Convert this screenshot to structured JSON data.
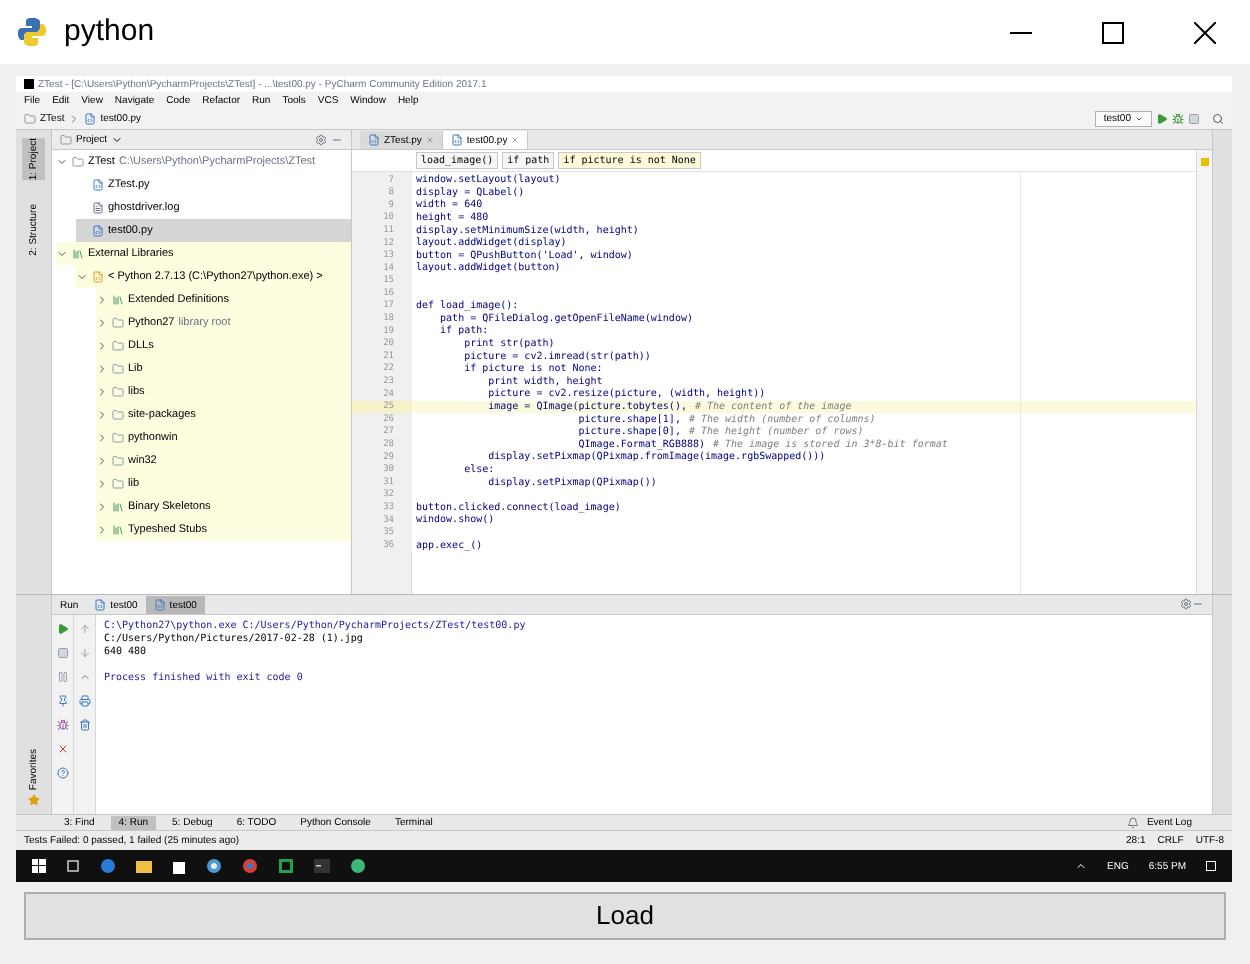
{
  "window": {
    "title": "python"
  },
  "ide": {
    "title": "ZTest - [C:\\Users\\Python\\PycharmProjects\\ZTest] - ...\\test00.py - PyCharm Community Edition 2017.1",
    "menu": [
      "File",
      "Edit",
      "View",
      "Navigate",
      "Code",
      "Refactor",
      "Run",
      "Tools",
      "VCS",
      "Window",
      "Help"
    ],
    "breadcrumb": [
      "ZTest",
      "test00.py"
    ],
    "run_config": "test00",
    "left_strip": [
      "1: Project",
      "2: Structure"
    ],
    "project_header": "Project",
    "tree": [
      {
        "label": "ZTest",
        "note": "C:\\Users\\Python\\PycharmProjects\\ZTest",
        "kind": "folder",
        "expanded": true,
        "selected": false,
        "children": [
          {
            "label": "ZTest.py",
            "kind": "py",
            "selected": false
          },
          {
            "label": "ghostdriver.log",
            "kind": "file",
            "selected": false
          },
          {
            "label": "test00.py",
            "kind": "py",
            "selected": true
          }
        ]
      },
      {
        "label": "External Libraries",
        "kind": "lib",
        "expanded": true,
        "selected": false,
        "children": [
          {
            "label": "< Python 2.7.13 (C:\\Python27\\python.exe) >",
            "kind": "python",
            "expanded": true,
            "selected": false,
            "children": [
              {
                "label": "Extended Definitions",
                "kind": "lib",
                "expanded": false,
                "selected": false
              },
              {
                "label": "Python27",
                "note": "library root",
                "kind": "folder",
                "expanded": false,
                "selected": false
              },
              {
                "label": "DLLs",
                "kind": "folder",
                "expanded": false,
                "selected": false
              },
              {
                "label": "Lib",
                "kind": "folder",
                "expanded": false,
                "selected": false
              },
              {
                "label": "libs",
                "kind": "folder",
                "expanded": false,
                "selected": false
              },
              {
                "label": "site-packages",
                "kind": "folder",
                "expanded": false,
                "selected": false
              },
              {
                "label": "pythonwin",
                "kind": "folder",
                "expanded": false,
                "selected": false
              },
              {
                "label": "win32",
                "kind": "folder",
                "expanded": false,
                "selected": false
              },
              {
                "label": "lib",
                "kind": "folder",
                "expanded": false,
                "selected": false
              },
              {
                "label": "Binary Skeletons",
                "kind": "lib",
                "expanded": false,
                "selected": false
              },
              {
                "label": "Typeshed Stubs",
                "kind": "lib",
                "expanded": false,
                "selected": false
              }
            ]
          }
        ]
      }
    ],
    "editor_tabs": [
      {
        "label": "ZTest.py",
        "selected": false
      },
      {
        "label": "test00.py",
        "selected": true
      }
    ],
    "code_breadcrumbs": [
      "load_image()",
      "if path",
      "if picture is not None"
    ],
    "code": [
      {
        "num": "7",
        "code": "window.setLayout(layout)",
        "current": false
      },
      {
        "num": "8",
        "code": "display = QLabel()",
        "current": false
      },
      {
        "num": "9",
        "code": "width = 640",
        "current": false
      },
      {
        "num": "10",
        "code": "height = 480",
        "current": false
      },
      {
        "num": "11",
        "code": "display.setMinimumSize(width, height)",
        "current": false
      },
      {
        "num": "12",
        "code": "layout.addWidget(display)",
        "current": false
      },
      {
        "num": "13",
        "code": "button = QPushButton('Load', window)",
        "current": false
      },
      {
        "num": "14",
        "code": "layout.addWidget(button)",
        "current": false
      },
      {
        "num": "15",
        "current": false
      },
      {
        "num": "16",
        "current": false
      },
      {
        "num": "17",
        "code": "def load_image():",
        "current": false
      },
      {
        "num": "18",
        "code": "    path = QFileDialog.getOpenFileName(window)",
        "current": false
      },
      {
        "num": "19",
        "code": "    if path:",
        "current": false
      },
      {
        "num": "20",
        "code": "        print str(path)",
        "current": false
      },
      {
        "num": "21",
        "code": "        picture = cv2.imread(str(path))",
        "current": false
      },
      {
        "num": "22",
        "code": "        if picture is not None:",
        "current": false
      },
      {
        "num": "23",
        "code": "            print width, height",
        "current": false
      },
      {
        "num": "24",
        "code": "            picture = cv2.resize(picture, (width, height))",
        "current": false
      },
      {
        "num": "25",
        "code": "            image = QImage(picture.tobytes(),",
        "comment": "# The content of the image",
        "current": true
      },
      {
        "num": "26",
        "code": "                           picture.shape[1],",
        "comment": "# The width (number of columns)",
        "current": false
      },
      {
        "num": "27",
        "code": "                           picture.shape[0],",
        "comment": "# The height (number of rows)",
        "current": false
      },
      {
        "num": "28",
        "code": "                           QImage.Format_RGB888)",
        "comment": "# The image is stored in 3*8-bit format",
        "current": false
      },
      {
        "num": "29",
        "code": "            display.setPixmap(QPixmap.fromImage(image.rgbSwapped()))",
        "current": false
      },
      {
        "num": "30",
        "code": "        else:",
        "current": false
      },
      {
        "num": "31",
        "code": "            display.setPixmap(QPixmap())",
        "current": false
      },
      {
        "num": "32",
        "current": false
      },
      {
        "num": "33",
        "code": "button.clicked.connect(load_image)",
        "current": false
      },
      {
        "num": "34",
        "code": "window.show()",
        "current": false
      },
      {
        "num": "35",
        "current": false
      },
      {
        "num": "36",
        "code": "app.exec_()",
        "current": false
      }
    ],
    "run_tabs": [
      {
        "label": "Run",
        "selected": false
      },
      {
        "label": "test00",
        "selected": false
      },
      {
        "label": "test00",
        "selected": true
      }
    ],
    "run_side_label": "Favorites",
    "console": [
      {
        "text": "C:\\Python27\\python.exe C:/Users/Python/PycharmProjects/ZTest/test00.py",
        "kind": "command"
      },
      {
        "text": "C:/Users/Python/Pictures/2017-02-28 (1).jpg",
        "kind": "output"
      },
      {
        "text": "640 480",
        "kind": "output"
      },
      {
        "kind": "blank"
      },
      {
        "text": "Process finished with exit code 0",
        "kind": "command"
      }
    ],
    "tool_tabs": [
      {
        "label": "3: Find",
        "selected": false
      },
      {
        "label": "4: Run",
        "selected": true
      },
      {
        "label": "5: Debug",
        "selected": false
      },
      {
        "label": "6: TODO",
        "selected": false
      },
      {
        "label": "Python Console",
        "selected": false
      },
      {
        "label": "Terminal",
        "selected": false
      }
    ],
    "event_log": "Event Log",
    "status": {
      "message": "Tests Failed: 0 passed, 1 failed (25 minutes ago)",
      "position": "28:1",
      "line_sep": "CRLF",
      "encoding": "UTF-8"
    },
    "taskbar": {
      "lang": "ENG",
      "time": "6:55 PM"
    }
  },
  "load_button": "Load"
}
